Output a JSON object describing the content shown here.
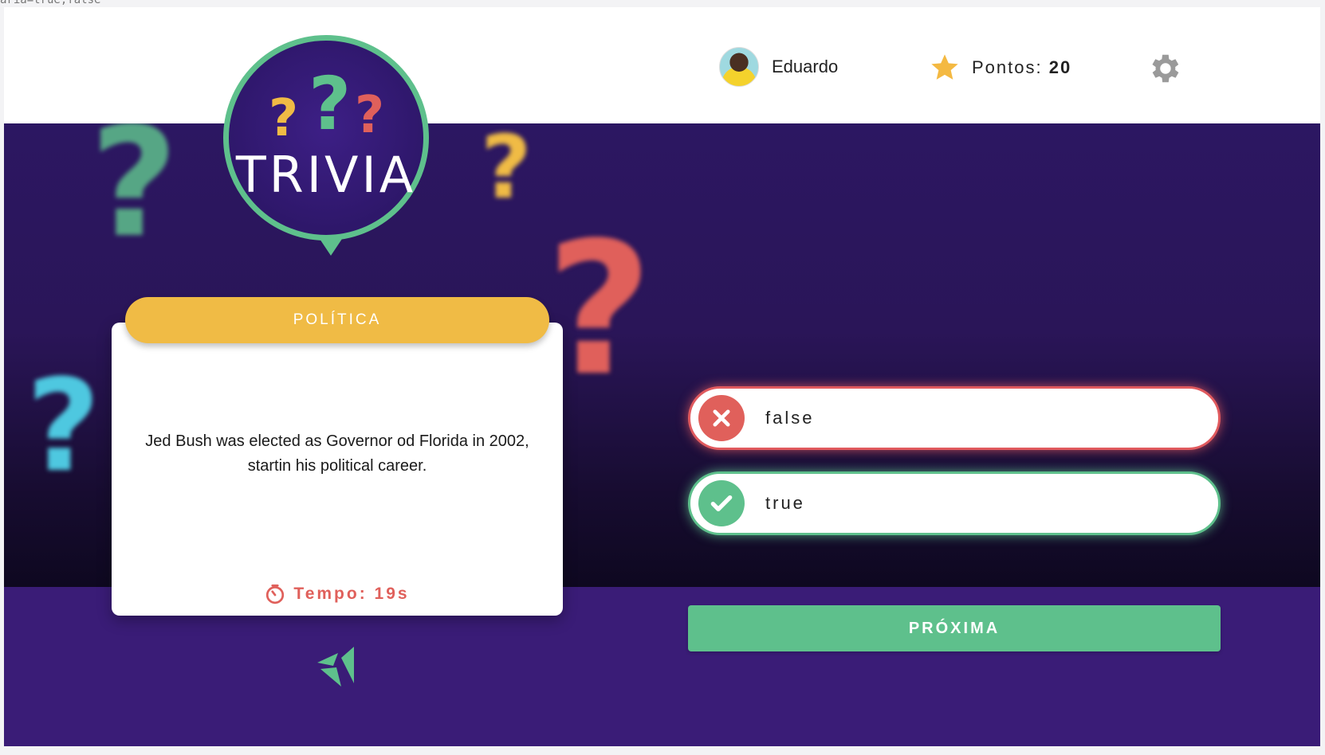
{
  "url_fragment": "aria=true;false",
  "header": {
    "user_name": "Eduardo",
    "points_label": "Pontos:",
    "points_value": "20"
  },
  "logo": {
    "title": "TRIVIA"
  },
  "question_card": {
    "category": "POLÍTICA",
    "question": "Jed Bush was elected as Governor od Florida in 2002, startin his political career.",
    "timer": "Tempo: 19s"
  },
  "answers": [
    {
      "label": "false",
      "state": "wrong",
      "icon": "x-icon"
    },
    {
      "label": "true",
      "state": "correct",
      "icon": "check-icon"
    }
  ],
  "next_button": "PRÓXIMA",
  "colors": {
    "purple": "#2c1762",
    "green": "#5ec08c",
    "red": "#e0605b",
    "yellow": "#f0bb45"
  }
}
